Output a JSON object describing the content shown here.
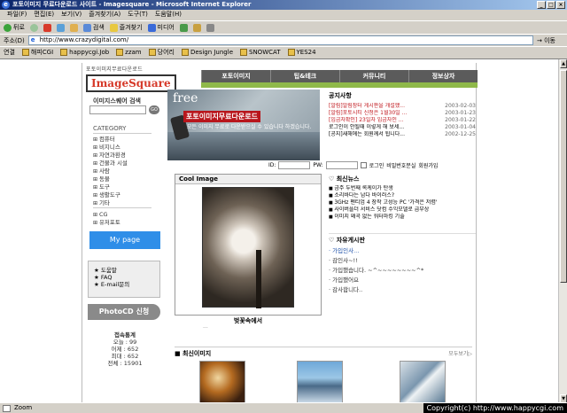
{
  "window": {
    "title": "포토이미지 무료다운로드 사이트 - Imagesquare - Microsoft Internet Explorer",
    "buttons": [
      "_",
      "□",
      "×"
    ]
  },
  "menubar": [
    "파일(F)",
    "편집(E)",
    "보기(V)",
    "즐겨찾기(A)",
    "도구(T)",
    "도움말(H)"
  ],
  "toolbar": {
    "back": "뒤로",
    "search": "검색",
    "favorites": "즐겨찾기",
    "media": "미디어"
  },
  "address": {
    "label": "주소(D)",
    "url": "http://www.crazydigital.com/",
    "go": "이동"
  },
  "links": {
    "label": "연결",
    "items": [
      "해피CGI",
      "happycgi.Job",
      "zzam",
      "당어리",
      "Design Jungle",
      "SNOWCAT",
      "YES24"
    ]
  },
  "site": {
    "logo_small": "포토이미지무료다운로드",
    "logo_big": "ImageSquare",
    "nav": [
      "포토이미지",
      "팁&테크",
      "커뮤니티",
      "정보상자"
    ],
    "search_title": "이미지스퀘어 검색",
    "search_go": "GO",
    "category_title": "CATEGORY",
    "categories": [
      "컴퓨터",
      "비지니스",
      "자연과환경",
      "건물과 시설",
      "사람",
      "동물",
      "도구",
      "생활도구",
      "기타"
    ],
    "categories2": [
      "CG",
      "유저포토"
    ],
    "mypage": "My page",
    "help_items": [
      "도움말",
      "FAQ",
      "E-mail문의"
    ],
    "photocd": "PhotoCD 신청",
    "stats": {
      "title": "접속통계",
      "lines": [
        "오늘 : 99",
        "어제 : 652",
        "최대 : 652",
        "전체 : 15901"
      ]
    },
    "banner": {
      "free": "free",
      "headline": "포토이미지무료다운로드",
      "sub": "모든 이미지 무료로 다운받으실 수 있습니다 하겠습니다."
    },
    "notice": {
      "title": "공지사항",
      "rows": [
        {
          "text": "[알림]알림장터 게시판을 개설했...",
          "date": "2003-02-03",
          "red": true
        },
        {
          "text": "[알림]포토시티 신청은 1월30일 ...",
          "date": "2003-01-23",
          "red": true
        },
        {
          "text": "[입금자확인] 23일자 입금자인 ...",
          "date": "2003-01-22",
          "red": true
        },
        {
          "text": "로그인이 안될때 이렇게 해 보세...",
          "date": "2003-01-04",
          "red": false
        },
        {
          "text": "[공지]새해에는 회원께서 됩니다...",
          "date": "2002-12-25",
          "red": false
        }
      ]
    },
    "login": {
      "id_label": "ID:",
      "pw_label": "PW:",
      "save_label": "로그인",
      "lost_label": "비밀번호분실",
      "join_label": "회원가입"
    },
    "cool": {
      "title": "Cool Image",
      "caption": "벚꽃속에서",
      "sub": "..."
    },
    "news": {
      "title": "♡ 최신뉴스",
      "items": [
        "금주 두번째 록케이가 탄생",
        "소리바다는 남다 바이러스?",
        "3GHz 펜티엄 4 장착 고성능 PC '가격은 저렴'",
        "사이버플더 서비스 닷컴 수익모델로 급부상",
        "이미지 왜곡 없는 워터마킹 기술"
      ]
    },
    "free": {
      "title": "♡ 자유게시판",
      "items": [
        {
          "text": "가입인사...",
          "blue": true
        },
        {
          "text": "감인사~!!",
          "blue": false
        },
        {
          "text": "가입했습니다. ~^~~~~~~~~^*",
          "blue": false
        },
        {
          "text": "가입했어요",
          "blue": false
        },
        {
          "text": "감사합니다..",
          "blue": false
        }
      ]
    },
    "recent": {
      "title": "■ 최신이미지",
      "more": "모두보기▷"
    }
  },
  "status": {
    "text": "Zoom",
    "copyright": "Copyright(c) http://www.happycgi.com"
  }
}
